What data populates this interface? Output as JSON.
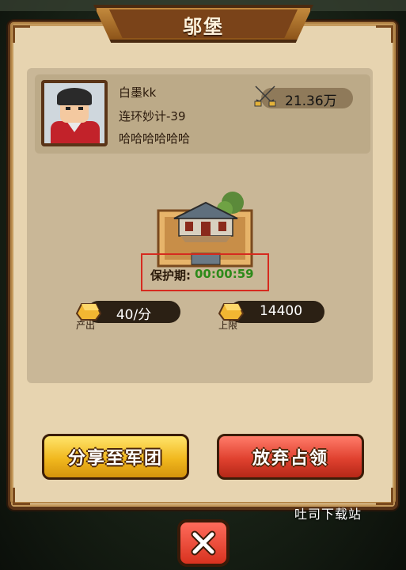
{
  "dialog": {
    "title": "邬堡"
  },
  "player": {
    "name": "白墨kk",
    "skill": "连环妙计-39",
    "motto": "哈哈哈哈哈哈",
    "power": "21.36万"
  },
  "castle": {
    "protect_label": "保护期:",
    "protect_time": "00:00:59"
  },
  "stats": {
    "output_value": "40/分",
    "output_tag": "产出",
    "cap_value": "14400",
    "cap_tag": "上限"
  },
  "buttons": {
    "share_label": "分享至军团",
    "abandon_label": "放弃占领"
  },
  "watermark": "吐司下载站",
  "colors": {
    "panel": "#e7d4b0",
    "frame": "#5a3417",
    "yellow_button": "#f1b81e",
    "red_button": "#e0412f",
    "protect_time": "#2d8a1a",
    "highlight_box": "#d62a1f"
  }
}
